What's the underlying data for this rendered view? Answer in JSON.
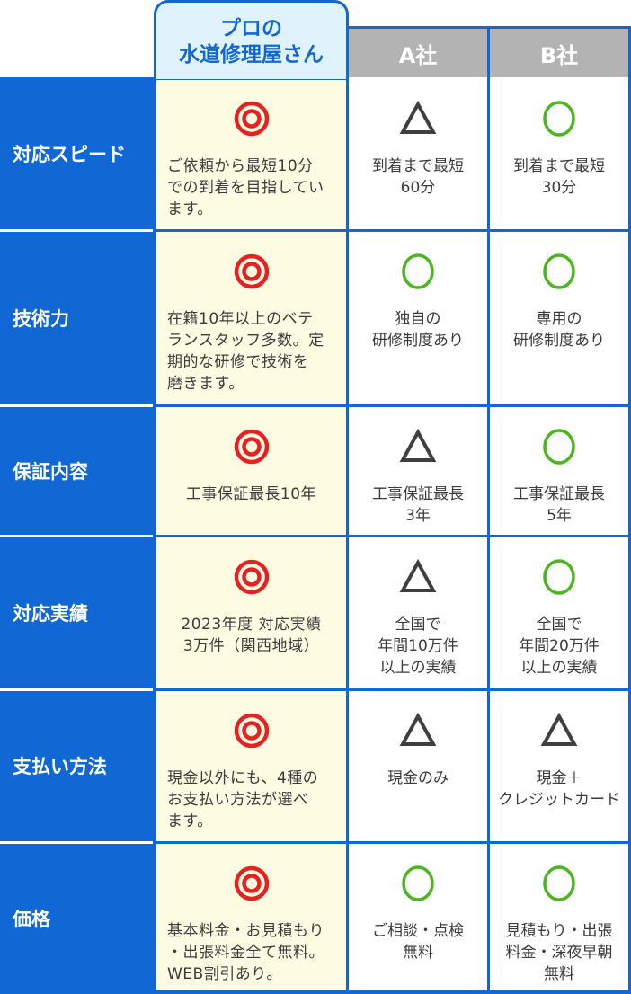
{
  "header": {
    "highlight_line1": "プロの",
    "highlight_line2": "水道修理屋さん",
    "company_a": "A社",
    "company_b": "B社"
  },
  "colors": {
    "brand_blue": "#1168d4",
    "highlight_bg": "#fefbe3",
    "header_highlight_bg": "#e0f3fb",
    "header_gray": "#b3b3b3",
    "double_circle_red": "#e52222",
    "circle_green": "#4cb520",
    "triangle_dark": "#3f3f3f"
  },
  "rating_legend": {
    "double-circle": "◎",
    "circle": "○",
    "triangle": "△"
  },
  "rows": [
    {
      "label": "対応スピード",
      "pro": {
        "rating": "double-circle",
        "text": "ご依頼から最短10分\nでの到着を目指してい\nます。"
      },
      "a": {
        "rating": "triangle",
        "text": "到着まで最短\n60分"
      },
      "b": {
        "rating": "circle",
        "text": "到着まで最短\n30分"
      }
    },
    {
      "label": "技術力",
      "pro": {
        "rating": "double-circle",
        "text": "在籍10年以上のベテ\nランスタッフ多数。定\n期的な研修で技術を\n磨きます。"
      },
      "a": {
        "rating": "circle",
        "text": "独自の\n研修制度あり"
      },
      "b": {
        "rating": "circle",
        "text": "専用の\n研修制度あり"
      }
    },
    {
      "label": "保証内容",
      "pro": {
        "rating": "double-circle",
        "text": "工事保証最長10年"
      },
      "a": {
        "rating": "triangle",
        "text": "工事保証最長\n3年"
      },
      "b": {
        "rating": "circle",
        "text": "工事保証最長\n5年"
      }
    },
    {
      "label": "対応実績",
      "pro": {
        "rating": "double-circle",
        "text": "2023年度 対応実績\n3万件（関西地域）"
      },
      "a": {
        "rating": "triangle",
        "text": "全国で\n年間10万件\n以上の実績"
      },
      "b": {
        "rating": "circle",
        "text": "全国で\n年間20万件\n以上の実績"
      }
    },
    {
      "label": "支払い方法",
      "pro": {
        "rating": "double-circle",
        "text": "現金以外にも、4種の\nお支払い方法が選べ\nます。"
      },
      "a": {
        "rating": "triangle",
        "text": "現金のみ"
      },
      "b": {
        "rating": "triangle",
        "text": "現金＋\nクレジットカード"
      }
    },
    {
      "label": "価格",
      "pro": {
        "rating": "double-circle",
        "text": "基本料金・お見積もり\n・出張料金全て無料。\nWEB割引あり。"
      },
      "a": {
        "rating": "circle",
        "text": "ご相談・点検\n無料"
      },
      "b": {
        "rating": "circle",
        "text": "見積もり・出張\n料金・深夜早朝\n無料"
      }
    }
  ]
}
